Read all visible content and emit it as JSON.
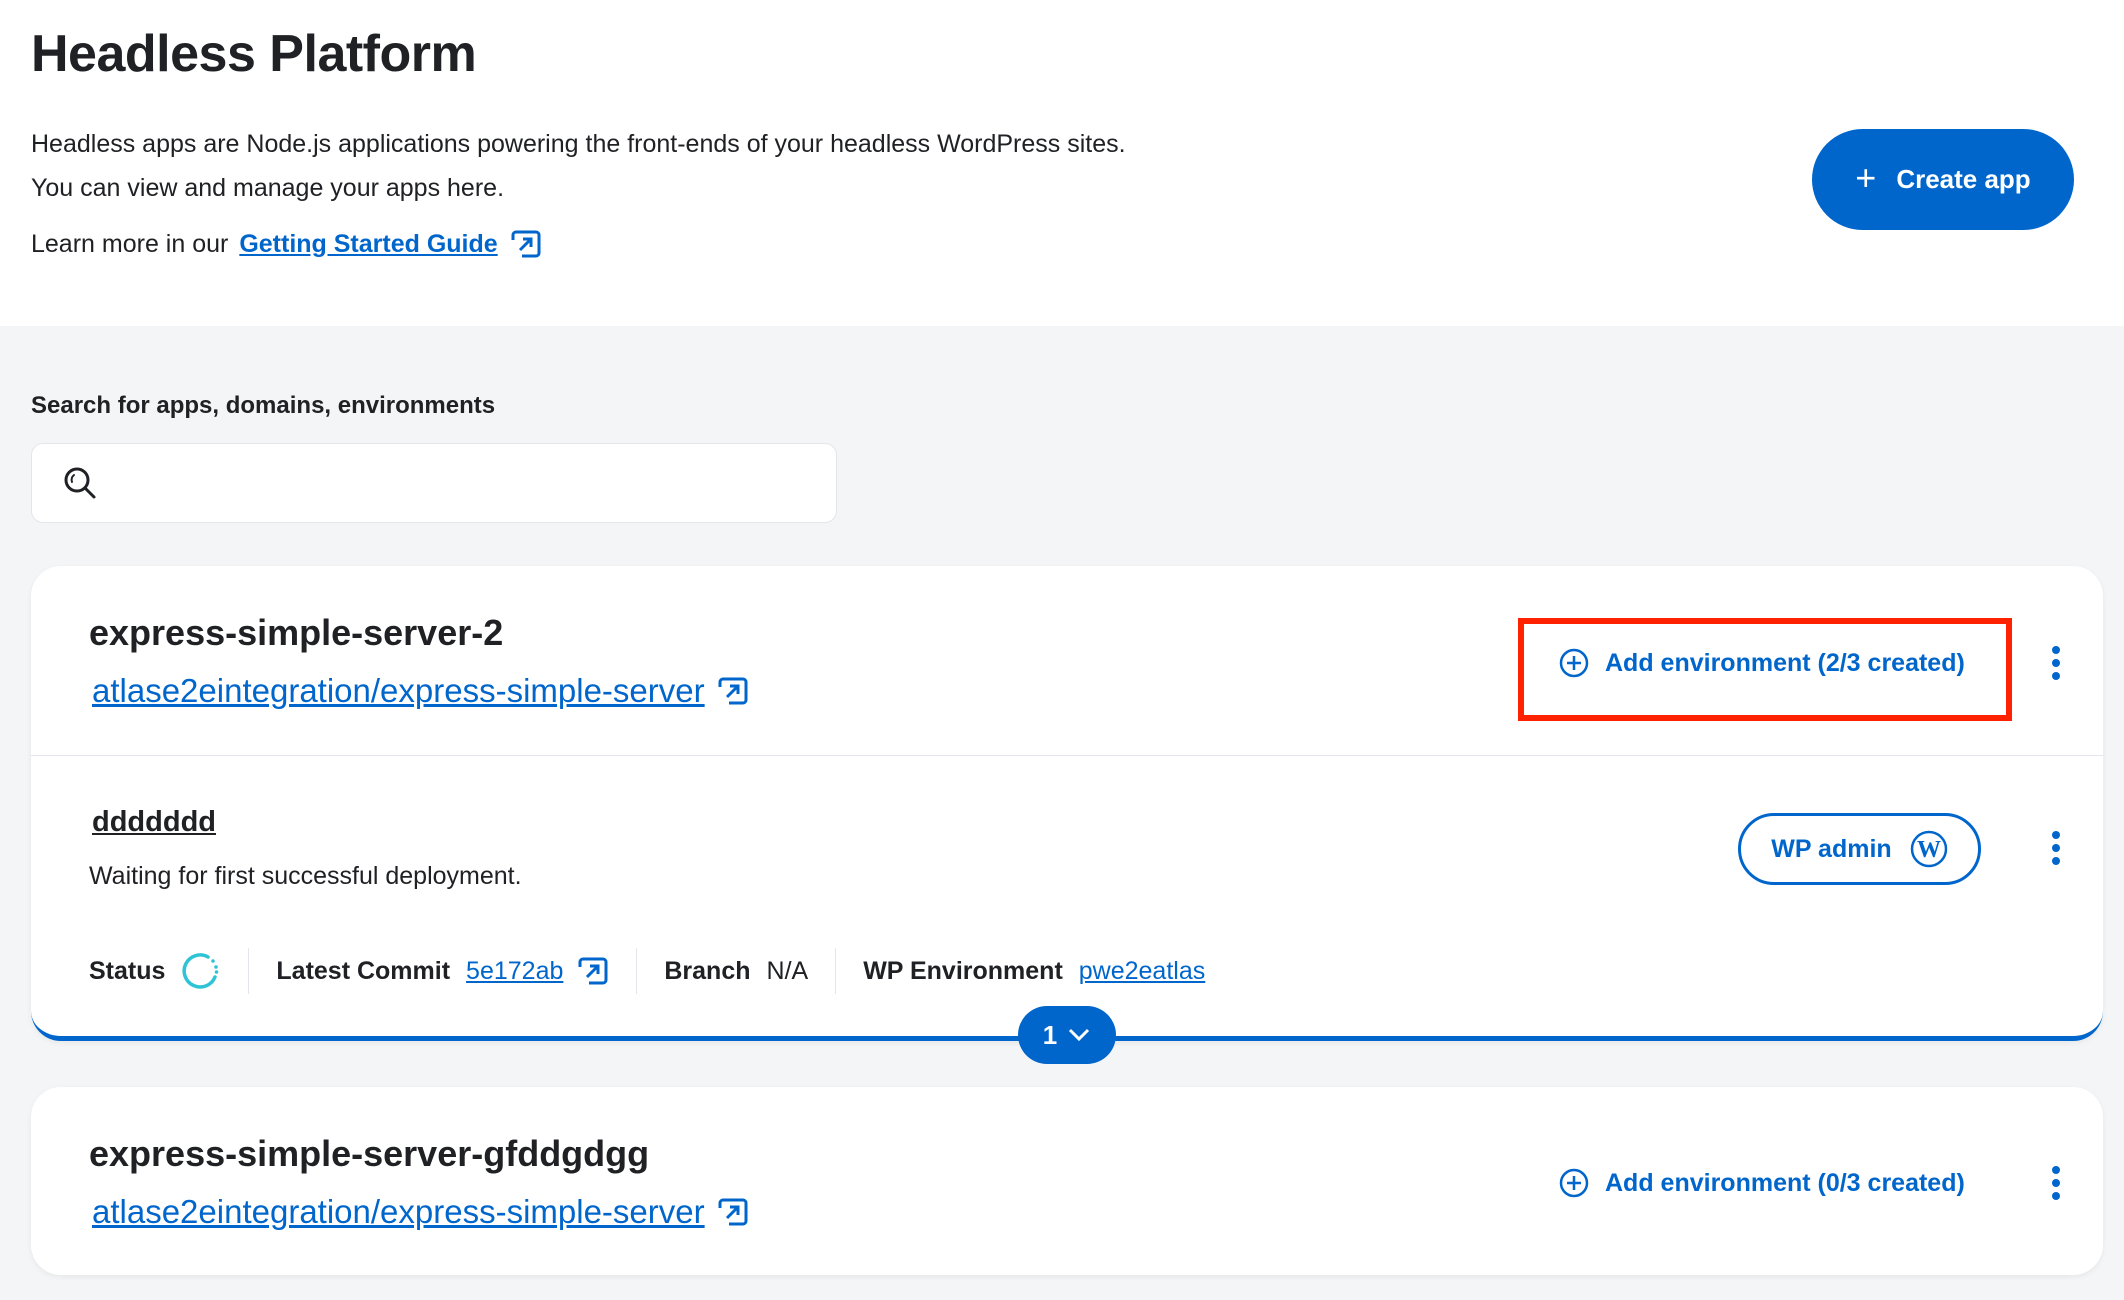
{
  "header": {
    "title": "Headless Platform",
    "intro_line1": "Headless apps are Node.js applications powering the front-ends of your headless WordPress sites.",
    "intro_line2": "You can view and manage your apps here.",
    "learn_prefix": "Learn more in our",
    "learn_link": "Getting Started Guide",
    "create_button": "Create app",
    "create_icon": "plus-icon"
  },
  "search": {
    "label": "Search for apps, domains, environments",
    "value": "",
    "placeholder": "",
    "icon": "search-icon"
  },
  "apps": [
    {
      "name": "express-simple-server-2",
      "repo": "atlase2eintegration/express-simple-server",
      "add_environment": "Add environment (2/3 created)",
      "highlighted": true,
      "environments": [
        {
          "name": "ddddddd",
          "description": "Waiting for first successful deployment.",
          "wp_admin_label": "WP admin",
          "status_label": "Status",
          "status_state": "in-progress",
          "commit_label": "Latest Commit",
          "commit_value": "5e172ab",
          "branch_label": "Branch",
          "branch_value": "N/A",
          "wp_env_label": "WP Environment",
          "wp_env_value": "pwe2eatlas"
        }
      ],
      "environment_count": "1"
    },
    {
      "name": "express-simple-server-gfddgdgg",
      "repo": "atlase2eintegration/express-simple-server",
      "add_environment": "Add environment (0/3 created)",
      "highlighted": false
    }
  ],
  "colors": {
    "brand": "#0066cc",
    "highlight": "#ff2200",
    "status_pending": "#2ec4d6",
    "background": "#f3f5f7"
  }
}
